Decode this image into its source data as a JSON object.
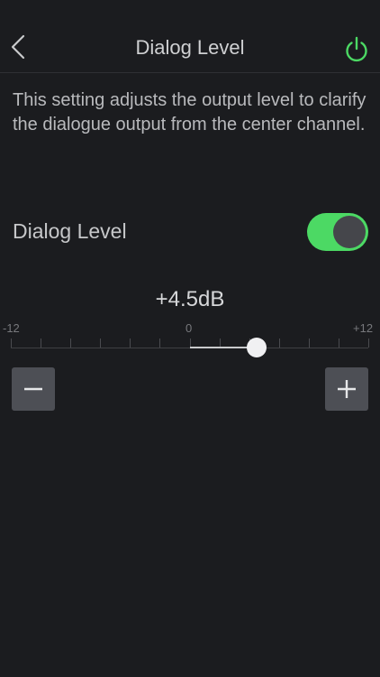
{
  "header": {
    "title": "Dialog Level",
    "back_icon": "chevron-left-icon",
    "power_icon": "power-icon",
    "power_color": "#4cd964"
  },
  "description": "This setting adjusts the output level to clarify the dialogue output from the center channel.",
  "dialog_toggle": {
    "label": "Dialog Level",
    "state": "on",
    "on_color": "#4cd964"
  },
  "slider": {
    "value_text": "+4.5dB",
    "value": 4.5,
    "min": -12,
    "max": 12,
    "min_label": "-12",
    "mid_label": "0",
    "max_label": "+12",
    "step": 1
  },
  "stepper": {
    "minus_icon": "minus-icon",
    "plus_icon": "plus-icon"
  }
}
